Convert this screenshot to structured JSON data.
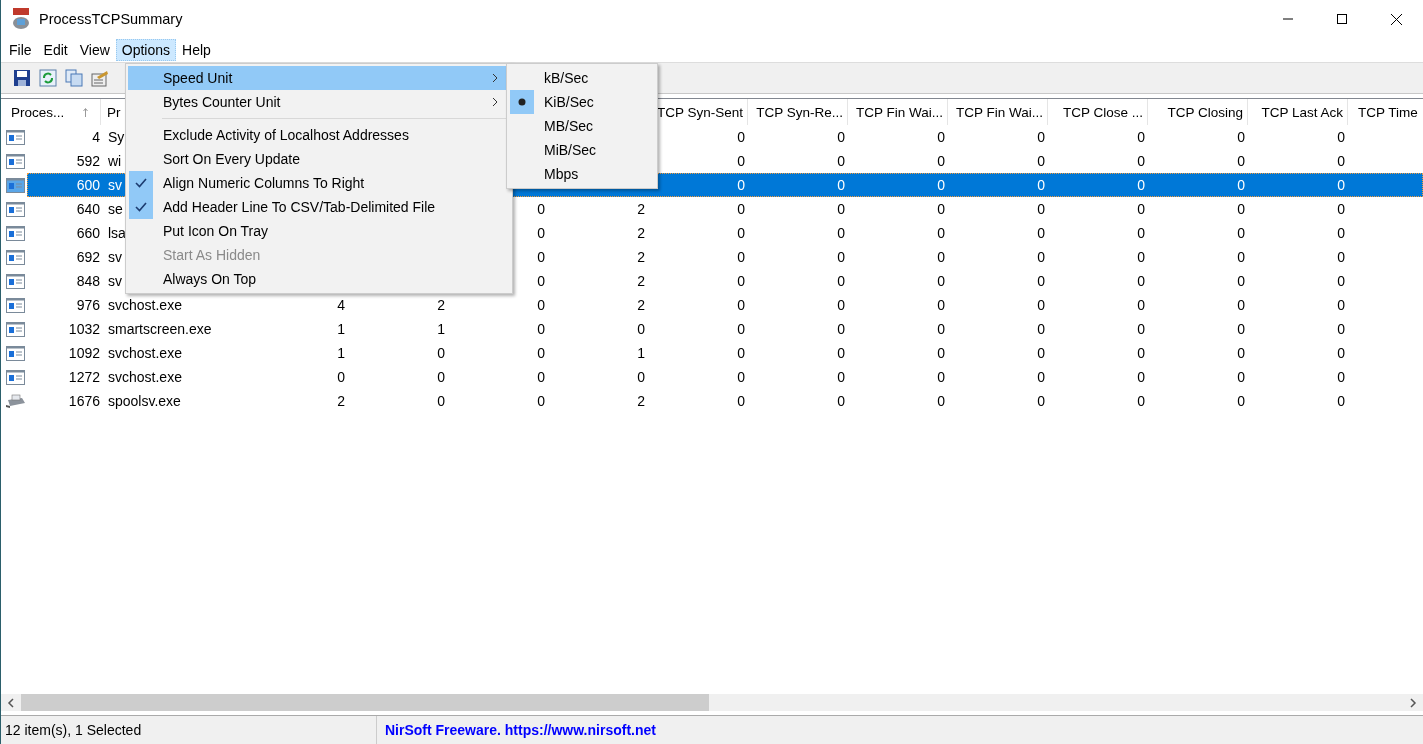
{
  "window": {
    "title": "ProcessTCPSummary"
  },
  "menubar": [
    {
      "label": "File",
      "selected": false
    },
    {
      "label": "Edit",
      "selected": false
    },
    {
      "label": "View",
      "selected": false
    },
    {
      "label": "Options",
      "selected": true
    },
    {
      "label": "Help",
      "selected": false
    }
  ],
  "toolbar": [
    {
      "kind": "save"
    },
    {
      "kind": "refresh"
    },
    {
      "kind": "copy"
    },
    {
      "kind": "properties"
    }
  ],
  "options_menu": [
    {
      "kind": "submenu",
      "label": "Speed Unit",
      "selected": true
    },
    {
      "kind": "submenu",
      "label": "Bytes Counter Unit",
      "selected": false
    },
    {
      "kind": "separator"
    },
    {
      "kind": "toggle",
      "label": "Exclude Activity of Localhost Addresses",
      "checked": false,
      "disabled": false
    },
    {
      "kind": "toggle",
      "label": "Sort On Every Update",
      "checked": false,
      "disabled": false
    },
    {
      "kind": "toggle",
      "label": "Align Numeric Columns To Right",
      "checked": true,
      "disabled": false
    },
    {
      "kind": "toggle",
      "label": "Add Header Line To CSV/Tab-Delimited File",
      "checked": true,
      "disabled": false
    },
    {
      "kind": "toggle",
      "label": "Put Icon On Tray",
      "checked": false,
      "disabled": false
    },
    {
      "kind": "toggle",
      "label": "Start As Hidden",
      "checked": false,
      "disabled": true
    },
    {
      "kind": "toggle",
      "label": "Always On Top",
      "checked": false,
      "disabled": false
    }
  ],
  "speed_unit_submenu": [
    {
      "label": "kB/Sec",
      "selected": false
    },
    {
      "label": "KiB/Sec",
      "selected": true
    },
    {
      "label": "MB/Sec",
      "selected": false
    },
    {
      "label": "MiB/Sec",
      "selected": false
    },
    {
      "label": "Mbps",
      "selected": false
    }
  ],
  "table": {
    "columns": [
      "Proces...",
      "Pr",
      "",
      "",
      "",
      "",
      "TCP Syn-Sent",
      "TCP Syn-Re...",
      "TCP Fin Wai...",
      "TCP Fin Wai...",
      "TCP Close ...",
      "TCP Closing",
      "TCP Last Ack",
      "TCP Time"
    ],
    "rows": [
      {
        "kind": "window",
        "selected": false,
        "cells": [
          "4",
          "Sy",
          "",
          "",
          "",
          "",
          "0",
          "0",
          "0",
          "0",
          "0",
          "0",
          "0"
        ]
      },
      {
        "kind": "window",
        "selected": false,
        "cells": [
          "592",
          "wi",
          "",
          "",
          "",
          "",
          "0",
          "0",
          "0",
          "0",
          "0",
          "0",
          "0"
        ]
      },
      {
        "kind": "window",
        "selected": true,
        "cells": [
          "600",
          "sv",
          "",
          "",
          "",
          "",
          "0",
          "0",
          "0",
          "0",
          "0",
          "0",
          "0"
        ]
      },
      {
        "kind": "window",
        "selected": false,
        "cells": [
          "640",
          "se",
          "",
          "",
          "0",
          "2",
          "0",
          "0",
          "0",
          "0",
          "0",
          "0",
          "0"
        ]
      },
      {
        "kind": "window",
        "selected": false,
        "cells": [
          "660",
          "lsa",
          "",
          "",
          "0",
          "2",
          "0",
          "0",
          "0",
          "0",
          "0",
          "0",
          "0"
        ]
      },
      {
        "kind": "window",
        "selected": false,
        "cells": [
          "692",
          "sv",
          "",
          "",
          "0",
          "2",
          "0",
          "0",
          "0",
          "0",
          "0",
          "0",
          "0"
        ]
      },
      {
        "kind": "window",
        "selected": false,
        "cells": [
          "848",
          "sv",
          "",
          "",
          "0",
          "2",
          "0",
          "0",
          "0",
          "0",
          "0",
          "0",
          "0"
        ]
      },
      {
        "kind": "window",
        "selected": false,
        "cells": [
          "976",
          "svchost.exe",
          "4",
          "2",
          "0",
          "2",
          "0",
          "0",
          "0",
          "0",
          "0",
          "0",
          "0"
        ]
      },
      {
        "kind": "window",
        "selected": false,
        "cells": [
          "1032",
          "smartscreen.exe",
          "1",
          "1",
          "0",
          "0",
          "0",
          "0",
          "0",
          "0",
          "0",
          "0",
          "0"
        ]
      },
      {
        "kind": "window",
        "selected": false,
        "cells": [
          "1092",
          "svchost.exe",
          "1",
          "0",
          "0",
          "1",
          "0",
          "0",
          "0",
          "0",
          "0",
          "0",
          "0"
        ]
      },
      {
        "kind": "window",
        "selected": false,
        "cells": [
          "1272",
          "svchost.exe",
          "0",
          "0",
          "0",
          "0",
          "0",
          "0",
          "0",
          "0",
          "0",
          "0",
          "0"
        ]
      },
      {
        "kind": "printer",
        "selected": false,
        "cells": [
          "1676",
          "spoolsv.exe",
          "2",
          "0",
          "0",
          "2",
          "0",
          "0",
          "0",
          "0",
          "0",
          "0",
          "0"
        ]
      }
    ]
  },
  "status_bar": {
    "count": "12 item(s), 1 Selected",
    "link": "NirSoft Freeware. https://www.nirsoft.net"
  }
}
